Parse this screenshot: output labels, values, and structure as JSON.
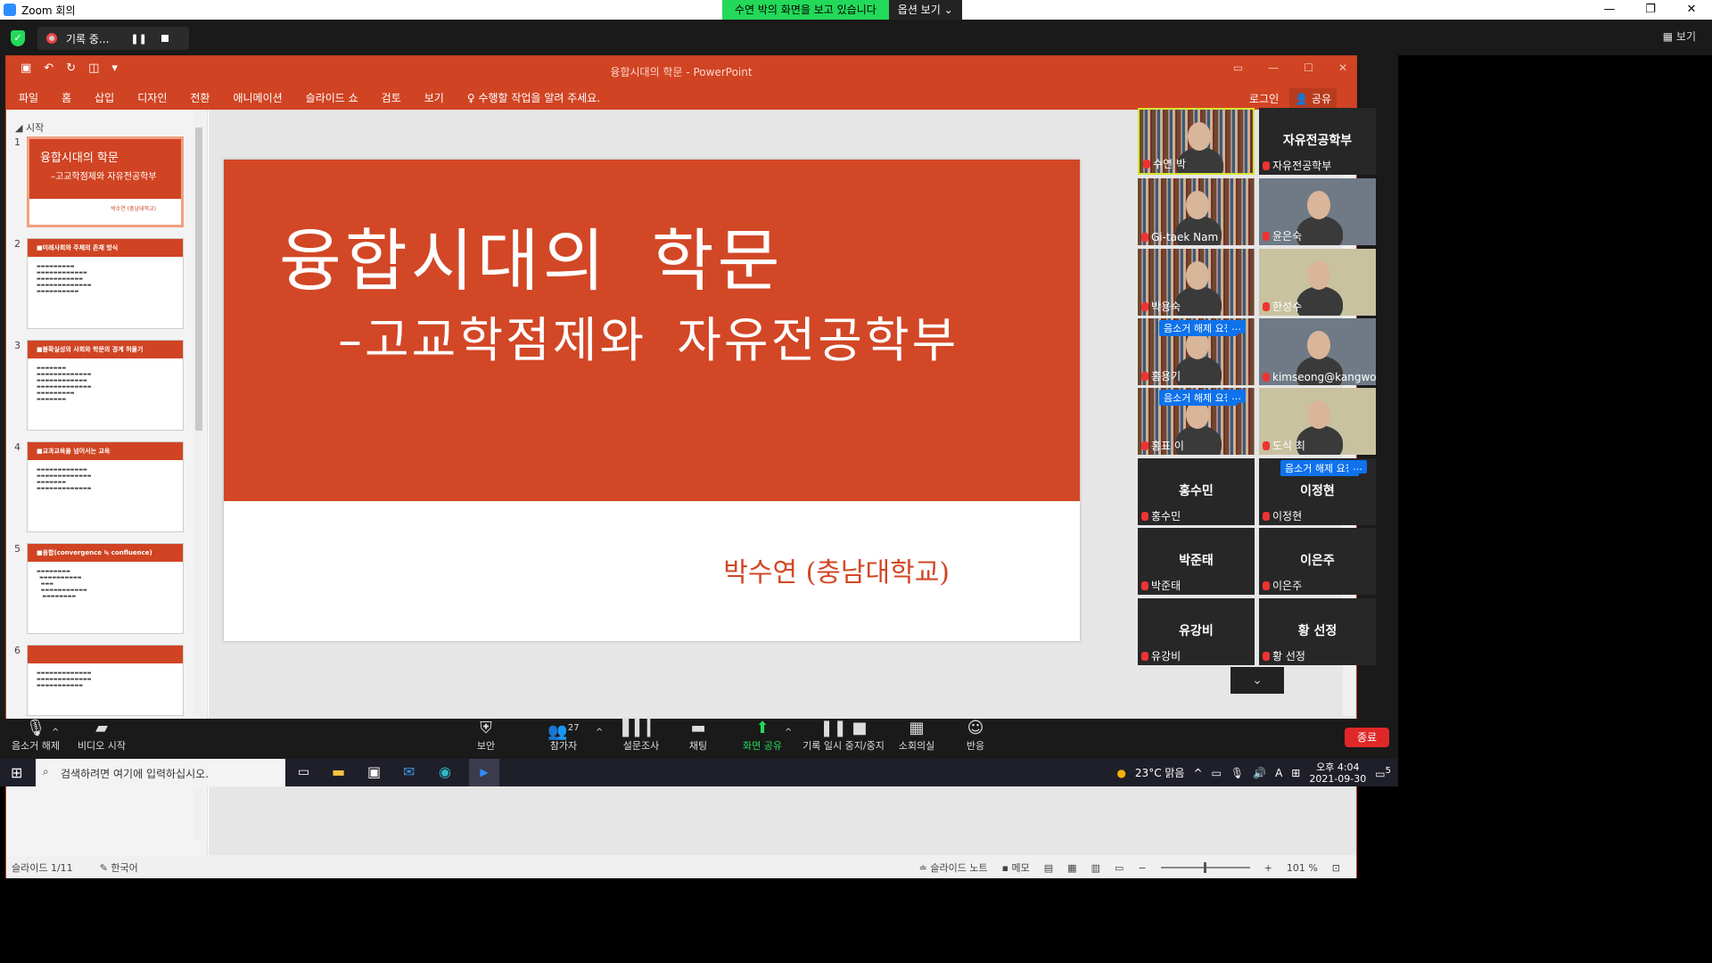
{
  "zoom": {
    "title": "Zoom 회의",
    "viewing_banner": "수연 박의 화면을 보고 있습니다",
    "view_options": "옵션 보기 ⌄",
    "record_label": "기록 중...",
    "view_button": "보기",
    "window_controls": [
      "—",
      "❐",
      "✕"
    ]
  },
  "ppt": {
    "title": "융합시대의 학문 - PowerPoint",
    "tabs": [
      "파일",
      "홈",
      "삽입",
      "디자인",
      "전환",
      "애니메이션",
      "슬라이드 쇼",
      "검토",
      "보기",
      "♀ 수행할 작업을 알려 주세요."
    ],
    "login": "로그인",
    "share": "공유",
    "section": "시작",
    "thumbs": [
      {
        "num": "1"
      },
      {
        "num": "2",
        "title": "■미래사회와 주체의 존재 방식"
      },
      {
        "num": "3",
        "title": "■불확실성의 사회와 학문의 경계 허물기"
      },
      {
        "num": "4",
        "title": "■교과교육을 넘어서는 교육"
      },
      {
        "num": "5",
        "title": "■융합(convergence ≒ confluence)"
      },
      {
        "num": "6",
        "title": ""
      }
    ],
    "slide": {
      "title": "융합시대의 학문",
      "subtitle": "–고교학점제와 자유전공학부",
      "author": "박수연 (충남대학교)"
    },
    "status": {
      "slide_of": "슬라이드 1/11",
      "language": "한국어",
      "notes": "슬라이드 노트",
      "comments": "메모",
      "zoom": "101 %"
    }
  },
  "gallery": [
    {
      "big": "",
      "label": "수연 박",
      "type": "video",
      "req": false
    },
    {
      "big": "자유전공학부",
      "label": "자유전공학부",
      "type": "name",
      "req": false
    },
    {
      "big": "",
      "label": "Gi-taek Nam",
      "type": "video",
      "req": false
    },
    {
      "big": "",
      "label": "윤은숙",
      "type": "video",
      "req": false
    },
    {
      "big": "",
      "label": "박용숙",
      "type": "video",
      "req": false
    },
    {
      "big": "",
      "label": "한성수",
      "type": "video",
      "req": false
    },
    {
      "big": "",
      "label": "홍용기",
      "type": "video",
      "req": true
    },
    {
      "big": "",
      "label": "kimseong@kangwon....",
      "type": "video",
      "req": false
    },
    {
      "big": "",
      "label": "홍표 이",
      "type": "video",
      "req": true
    },
    {
      "big": "",
      "label": "도식 최",
      "type": "video",
      "req": false
    },
    {
      "big": "홍수민",
      "label": "홍수민",
      "type": "name",
      "req": false
    },
    {
      "big": "이정현",
      "label": "이정현",
      "type": "name",
      "req": true
    },
    {
      "big": "박준태",
      "label": "박준태",
      "type": "name",
      "req": false
    },
    {
      "big": "이은주",
      "label": "이은주",
      "type": "name",
      "req": false
    },
    {
      "big": "유강비",
      "label": "유강비",
      "type": "name",
      "req": false
    },
    {
      "big": "황 선정",
      "label": "황 선정",
      "type": "name",
      "req": false
    }
  ],
  "unmute_request": "음소거 해제 요청",
  "toolbar": {
    "unmute": "음소거 해제",
    "video": "비디오 시작",
    "security": "보안",
    "participants": "참가자",
    "participant_count": "27",
    "polls": "설문조사",
    "chat": "채팅",
    "share": "화면 공유",
    "record": "기록 일시 중지/중지",
    "breakout": "소회의실",
    "reactions": "반응",
    "end": "종료"
  },
  "taskbar": {
    "search_placeholder": "검색하려면 여기에 입력하십시오.",
    "weather": "23°C 맑음",
    "time": "오후 4:04",
    "date": "2021-09-30",
    "notif": "5"
  }
}
